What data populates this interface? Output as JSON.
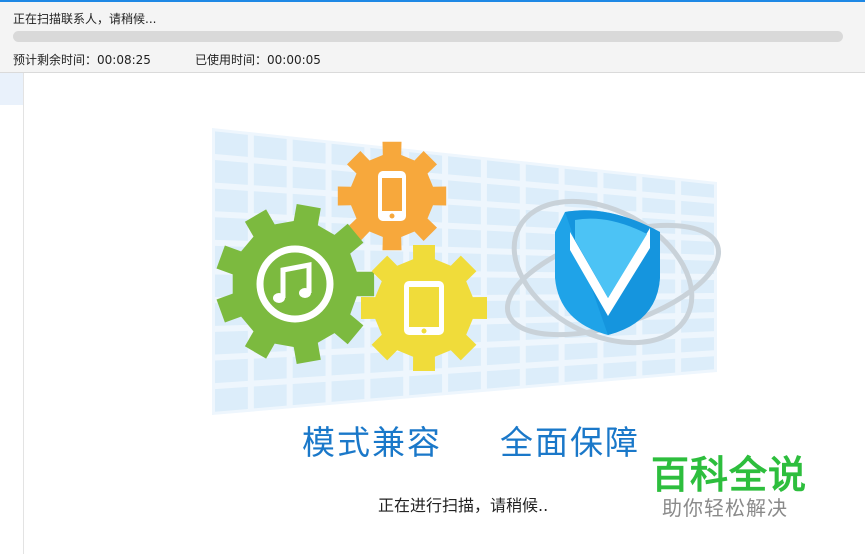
{
  "header": {
    "status_text": "正在扫描联系人，请稍候...",
    "progress_percent": 0,
    "remaining_label": "预计剩余时间：00:08:25",
    "used_label": "已使用时间：00:00:05"
  },
  "main": {
    "slogan_left": "模式兼容",
    "slogan_right": "全面保障",
    "scan_text": "正在进行扫描，请稍候.."
  },
  "watermark": {
    "title": "百科全说",
    "subtitle": "助你轻松解决"
  },
  "colors": {
    "accent": "#1e88e5",
    "gear_green": "#7cba3f",
    "gear_orange": "#f7a83c",
    "gear_yellow": "#f0dc3a",
    "shield_blue": "#1fa3e8",
    "watermark_green": "#2dbe3d"
  },
  "icons": {
    "music": "music-note-icon",
    "phone": "phone-icon",
    "tablet": "tablet-icon",
    "shield": "shield-check-icon"
  }
}
